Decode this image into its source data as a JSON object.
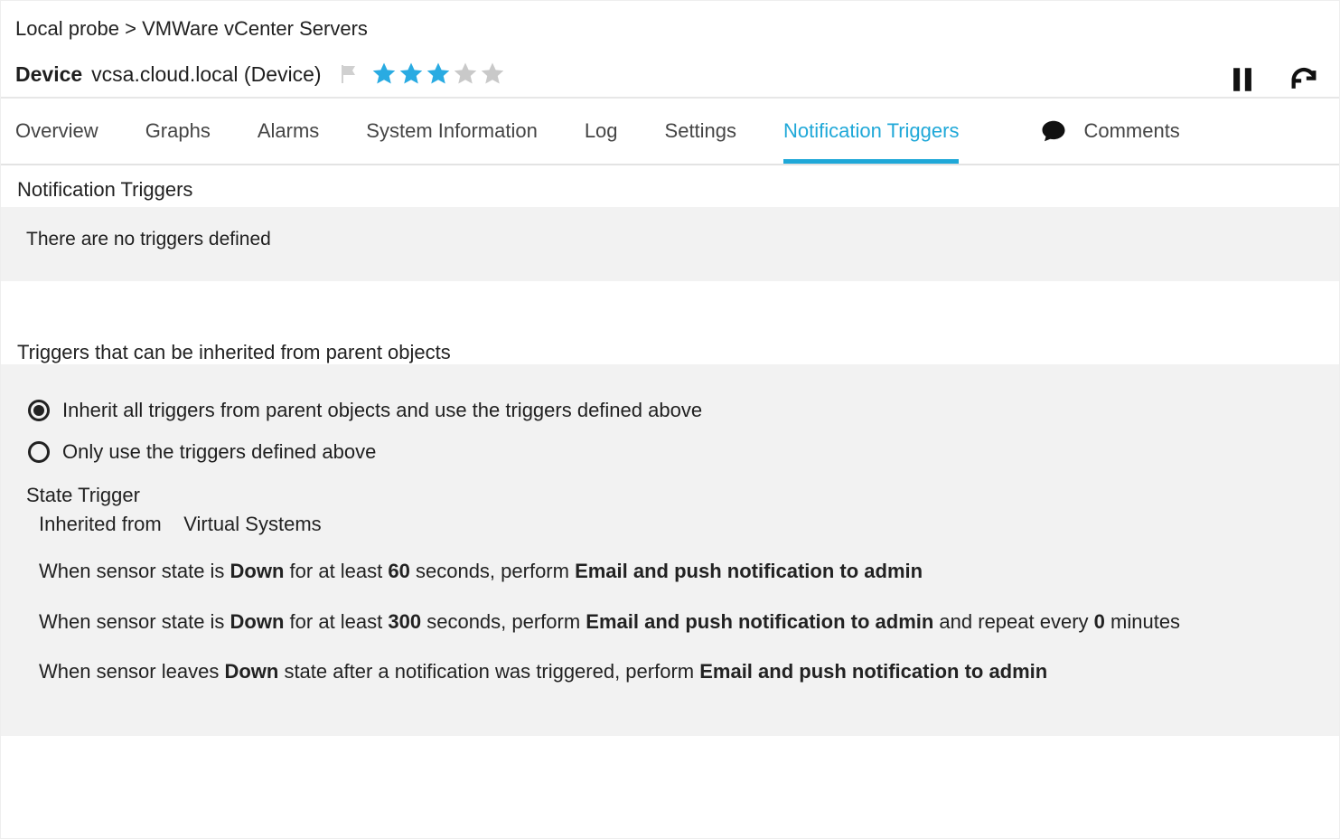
{
  "breadcrumb": {
    "parent": "Local probe",
    "sep": ">",
    "child": "VMWare vCenter Servers"
  },
  "device": {
    "label": "Device",
    "name": "vcsa.cloud.local (Device)",
    "rating_filled": 3,
    "rating_total": 5
  },
  "colors": {
    "accent": "#1fa8d8",
    "star_on": "#29abe2",
    "star_off": "#c9c9c9"
  },
  "tabs": [
    {
      "id": "overview",
      "label": "Overview",
      "active": false
    },
    {
      "id": "graphs",
      "label": "Graphs",
      "active": false
    },
    {
      "id": "alarms",
      "label": "Alarms",
      "active": false
    },
    {
      "id": "sysinfo",
      "label": "System Information",
      "active": false
    },
    {
      "id": "log",
      "label": "Log",
      "active": false
    },
    {
      "id": "settings",
      "label": "Settings",
      "active": false
    },
    {
      "id": "notif",
      "label": "Notification Triggers",
      "active": true
    }
  ],
  "comments_tab": {
    "label": "Comments"
  },
  "notif_section": {
    "title": "Notification Triggers",
    "empty_text": "There are no triggers defined"
  },
  "inherit_section": {
    "title": "Triggers that can be inherited from parent objects",
    "options": [
      {
        "id": "inherit-all",
        "label": "Inherit all triggers from parent objects and use the triggers defined above",
        "checked": true
      },
      {
        "id": "only-local",
        "label": "Only use the triggers defined above",
        "checked": false
      }
    ]
  },
  "state_trigger": {
    "heading": "State Trigger",
    "inherited_prefix": "Inherited from",
    "inherited_source": "Virtual Systems",
    "rules": [
      {
        "parts": [
          {
            "t": "When sensor state is "
          },
          {
            "t": "Down",
            "b": true
          },
          {
            "t": " for at least "
          },
          {
            "t": "60",
            "b": true
          },
          {
            "t": " seconds, perform "
          },
          {
            "t": "Email and push notification to admin",
            "b": true
          }
        ]
      },
      {
        "parts": [
          {
            "t": "When sensor state is "
          },
          {
            "t": "Down",
            "b": true
          },
          {
            "t": " for at least "
          },
          {
            "t": "300",
            "b": true
          },
          {
            "t": " seconds, perform "
          },
          {
            "t": "Email and push notification to admin",
            "b": true
          },
          {
            "t": " and repeat every "
          },
          {
            "t": "0",
            "b": true
          },
          {
            "t": " minutes"
          }
        ]
      },
      {
        "parts": [
          {
            "t": "When sensor leaves "
          },
          {
            "t": "Down",
            "b": true
          },
          {
            "t": " state after a notification was triggered, perform "
          },
          {
            "t": "Email and push notification to admin",
            "b": true
          }
        ]
      }
    ]
  }
}
